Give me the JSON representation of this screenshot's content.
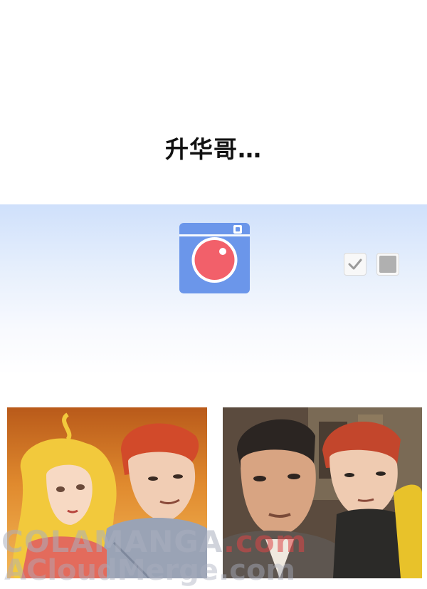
{
  "caption": "升华哥…",
  "icons": {
    "camera": "camera-icon",
    "check": "checkmark-icon",
    "stop": "stop-square-icon"
  },
  "colors": {
    "camera_body": "#6b96ea",
    "camera_lens": "#f2606a",
    "band_top": "#cfe0fb"
  },
  "watermark": {
    "line1_main": "COLAMANGA",
    "line1_suffix": ".com",
    "line2": "ACloudMerge.com"
  }
}
